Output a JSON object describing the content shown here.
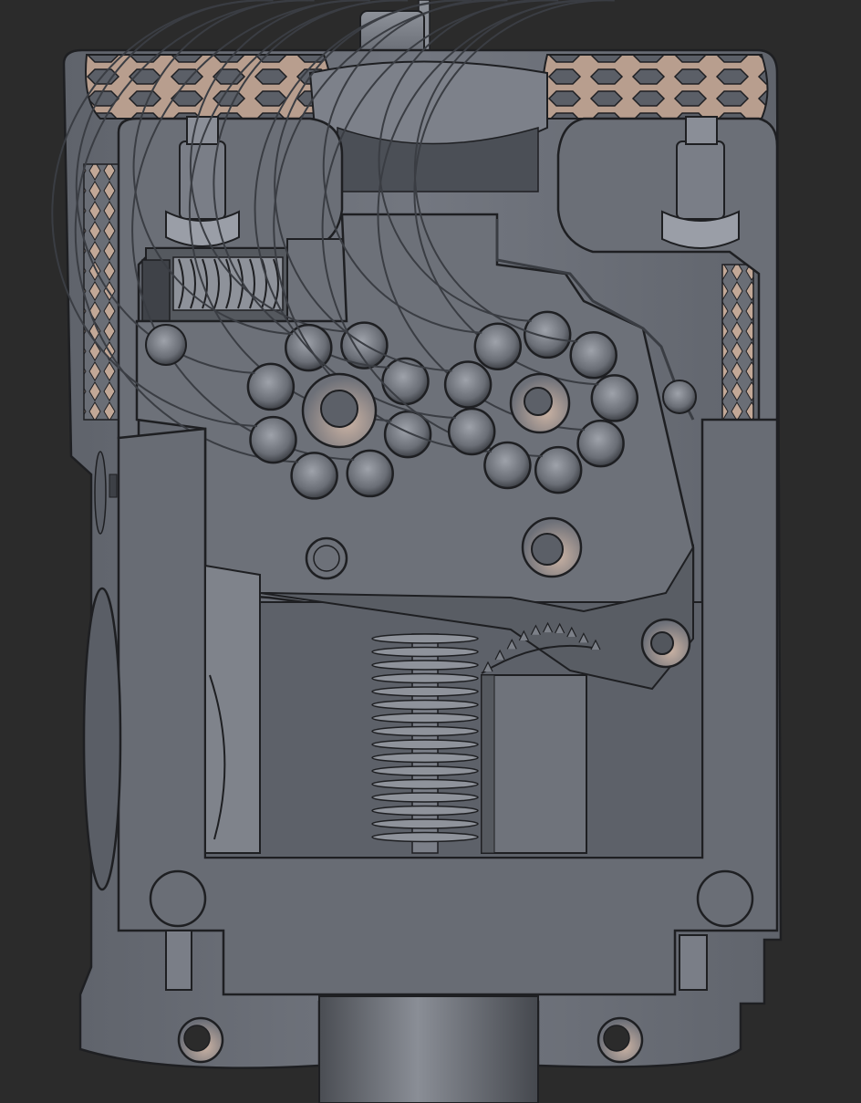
{
  "scene": {
    "subject": "extruder-cad-cross-section",
    "palette": {
      "background": "#2b2b2b",
      "body": "#6e727a",
      "body_dark": "#4e5259",
      "body_light": "#9a9ea6",
      "edge": "#1e1f22",
      "cavity": "#5a5e66",
      "highlight": "#c9b0a0",
      "hole_shadow": "#3a3d43"
    }
  }
}
